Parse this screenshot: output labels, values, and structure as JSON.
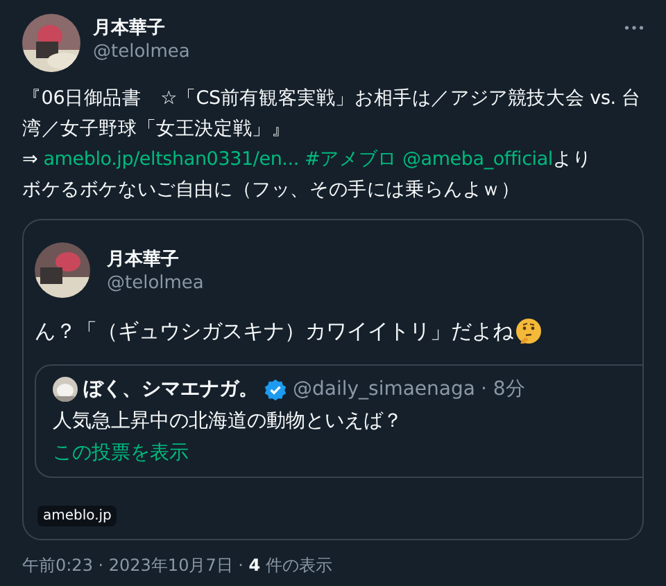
{
  "author": {
    "name": "月本華子",
    "handle": "@telolmea"
  },
  "body": [
    {
      "kind": "text",
      "text": "『06日御品書　☆「CS前有観客実戦」お相手は／アジア競技大会 vs. 台湾／女子野球「女王決定戦」』"
    },
    {
      "kind": "break"
    },
    {
      "kind": "text",
      "text": "⇒ "
    },
    {
      "kind": "link",
      "text": "ameblo.jp/eltshan0331/en..."
    },
    {
      "kind": "space"
    },
    {
      "kind": "link",
      "text": "#アメブロ"
    },
    {
      "kind": "space"
    },
    {
      "kind": "link",
      "text": "@ameba_official"
    },
    {
      "kind": "text",
      "text": "より"
    },
    {
      "kind": "break"
    },
    {
      "kind": "text",
      "text": "ボケるボケないご自由に（フッ、その手には乗らんよｗ）"
    }
  ],
  "card": {
    "author": {
      "name": "月本華子",
      "handle": "@telolmea"
    },
    "text": "ん？「（ギュウシガスキナ）カワイイトリ」だよね",
    "quote": {
      "name": "ぼく、シマエナガ。",
      "verified": true,
      "handle": "@daily_simaenaga",
      "time": "· 8分",
      "text": "人気急上昇中の北海道の動物といえば？",
      "link": "この投票を表示"
    },
    "domain": "ameblo.jp"
  },
  "footer": "午前0:23 · 2023年10月7日 · **4** 件の表示"
}
